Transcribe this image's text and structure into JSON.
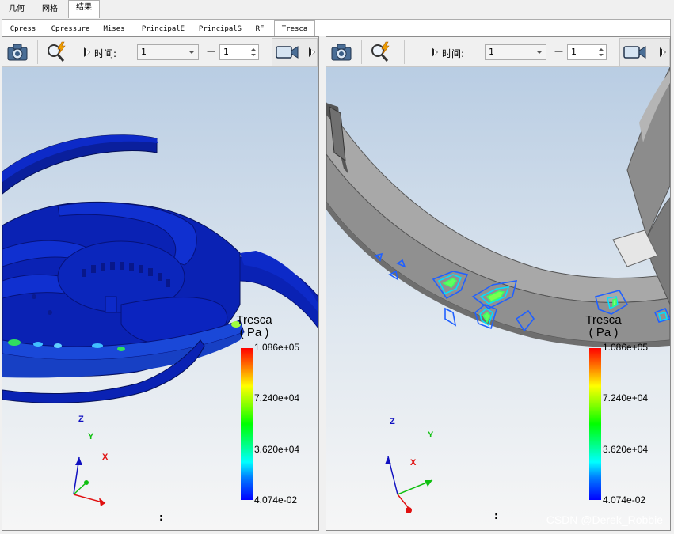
{
  "top_tabs": [
    {
      "label": "几何"
    },
    {
      "label": "网格"
    },
    {
      "label": "结果",
      "active": true
    }
  ],
  "result_tabs": [
    {
      "label": "Cpress"
    },
    {
      "label": "Cpressure"
    },
    {
      "label": "Mises"
    },
    {
      "label": "PrincipalE"
    },
    {
      "label": "PrincipalS"
    },
    {
      "label": "RF"
    },
    {
      "label": "Tresca",
      "active": true
    }
  ],
  "panels": [
    {
      "toolbar": {
        "screenshot_icon": "camera-icon",
        "query_icon": "magnifier-lightning-icon",
        "time_label": "时间:",
        "time_value": "1",
        "dash": "—",
        "step_value": "1",
        "animate_icon": "video-camera-icon"
      },
      "legend": {
        "title": "Tresca",
        "unit": "( Pa )",
        "max": "1.086e+05",
        "v2": "7.240e+04",
        "v1": "3.620e+04",
        "min": "4.074e-02"
      },
      "axes": {
        "x": "X",
        "y": "Y",
        "z": "Z"
      },
      "colon": ":"
    },
    {
      "toolbar": {
        "screenshot_icon": "camera-icon",
        "query_icon": "magnifier-lightning-icon",
        "time_label": "时间:",
        "time_value": "1",
        "dash": "—",
        "step_value": "1",
        "animate_icon": "video-camera-icon"
      },
      "legend": {
        "title": "Tresca",
        "unit": "( Pa )",
        "max": "1.086e+05",
        "v2": "7.240e+04",
        "v1": "3.620e+04",
        "min": "4.074e-02"
      },
      "axes": {
        "x": "X",
        "y": "Y",
        "z": "Z"
      },
      "colon": ":"
    }
  ],
  "watermark": "CSDN @Derek_Robbie",
  "colors": {
    "model_blue": "#0a22b4",
    "model_gray": "#8a8a8a",
    "axis_x": "#e01010",
    "axis_y": "#10c010",
    "axis_z": "#1010c0"
  }
}
